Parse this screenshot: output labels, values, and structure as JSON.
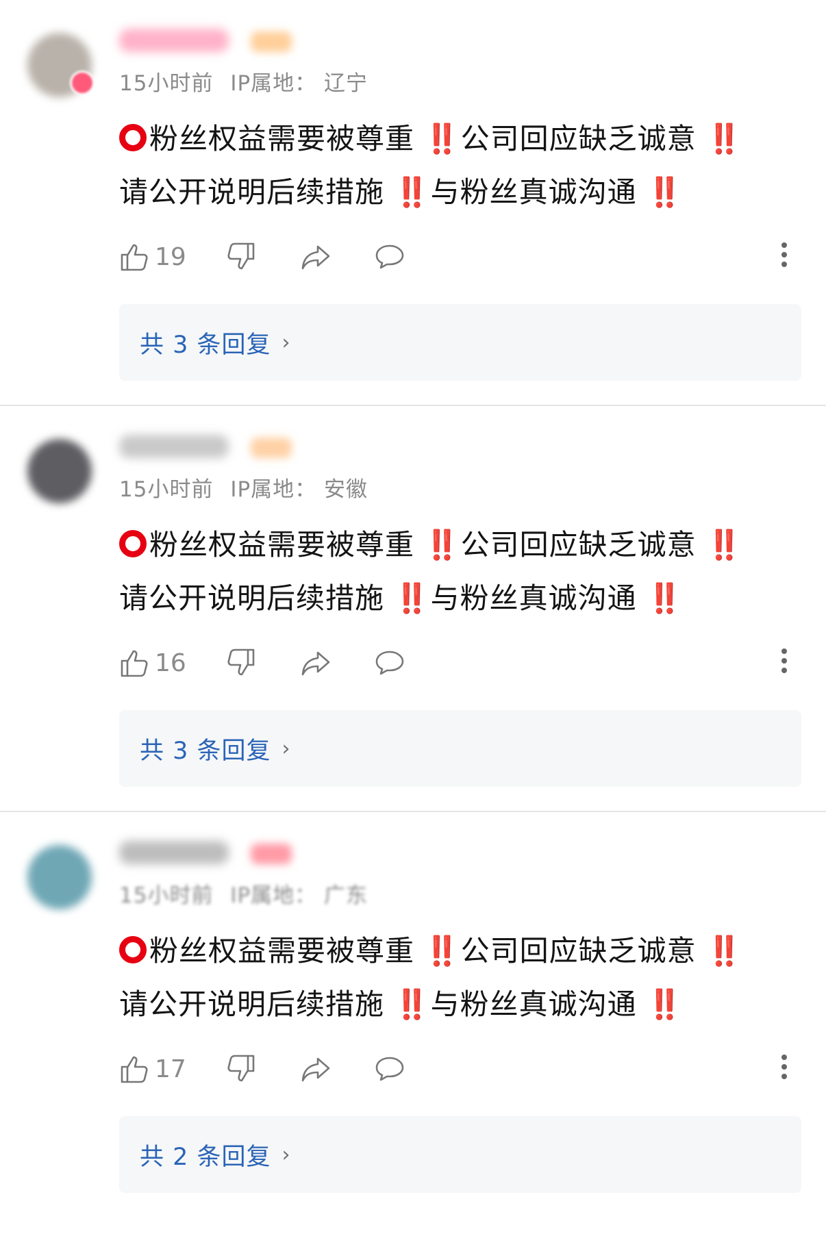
{
  "comments": [
    {
      "time": "15小时前",
      "ip_label": "IP属地：",
      "ip_location": "辽宁",
      "likes": "19",
      "replies_label": "共 3 条回复",
      "avatar_color": "#b9b2aa",
      "name_color": "#ffb2c8",
      "tag_color": "#ffcf9a",
      "has_badge": true
    },
    {
      "time": "15小时前",
      "ip_label": "IP属地：",
      "ip_location": "安徽",
      "likes": "16",
      "replies_label": "共 3 条回复",
      "avatar_color": "#5d5d62",
      "name_color": "#c9c9c9",
      "tag_color": "#ffd1a6",
      "has_badge": false
    },
    {
      "time": "15小时前",
      "ip_label": "IP属地：",
      "ip_location": "广东",
      "likes": "17",
      "replies_label": "共 2 条回复",
      "avatar_color": "#6fa7b5",
      "name_color": "#bdbdbd",
      "tag_color": "#ff9aa6",
      "has_badge": false
    }
  ],
  "message": {
    "p1": "粉丝权益需要被尊重",
    "mark1": "‼️",
    "p2": "公司回应缺乏诚意",
    "mark2": "‼️",
    "p3": "请公开说明后续措施",
    "mark3": "‼️",
    "p4": "与粉丝真诚沟通",
    "mark4": "‼️"
  },
  "colors": {
    "accent_red": "#e60012",
    "reply_link": "#2a64b7",
    "meta_gray": "#8a8a8a"
  },
  "icons": {
    "like": "thumbs-up-icon",
    "dislike": "thumbs-down-icon",
    "share": "share-icon",
    "reply": "comment-bubble-icon",
    "more": "more-vertical-icon",
    "chevron": "chevron-right-icon"
  }
}
